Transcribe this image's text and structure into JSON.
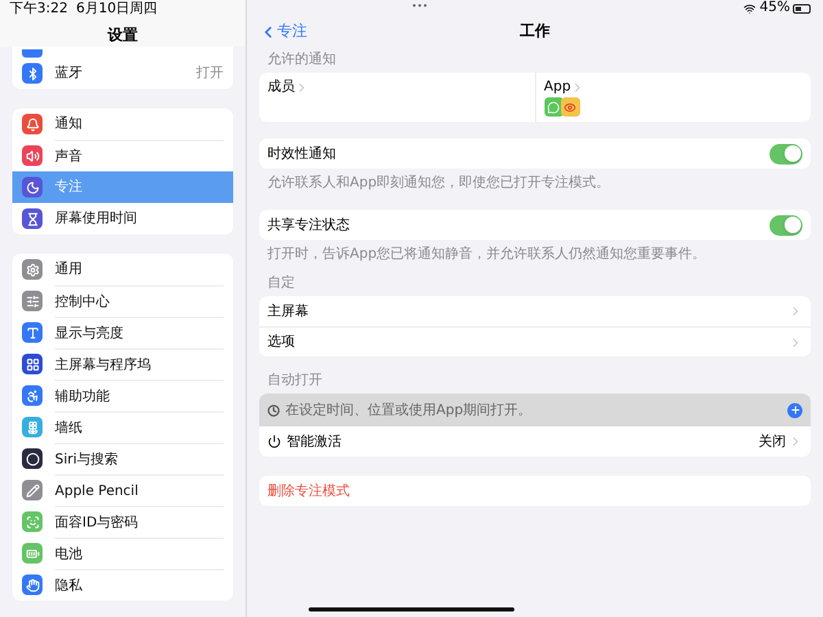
{
  "status_bar": {
    "time": "下午3:22",
    "date": "6月10日周四",
    "battery": "45%"
  },
  "sidebar": {
    "title": "设置",
    "groups": [
      {
        "items": [
          {
            "label": "蓝牙",
            "value": "打开",
            "color": "#3478f6",
            "selected": false
          }
        ]
      },
      {
        "items": [
          {
            "label": "通知",
            "color": "#eb4d3d",
            "selected": false
          },
          {
            "label": "声音",
            "color": "#eb445a",
            "selected": false
          },
          {
            "label": "专注",
            "color": "#5856d6",
            "selected": true
          },
          {
            "label": "屏幕使用时间",
            "color": "#5856d6",
            "selected": false
          }
        ]
      },
      {
        "items": [
          {
            "label": "通用",
            "color": "#8e8e93",
            "selected": false
          },
          {
            "label": "控制中心",
            "color": "#8e8e93",
            "selected": false
          },
          {
            "label": "显示与亮度",
            "color": "#3478f6",
            "selected": false
          },
          {
            "label": "主屏幕与程序坞",
            "color": "#2c4bd6",
            "selected": false
          },
          {
            "label": "辅助功能",
            "color": "#3478f6",
            "selected": false
          },
          {
            "label": "墙纸",
            "color": "#38aee0",
            "selected": false
          },
          {
            "label": "Siri与搜索",
            "color": "#2a2a40",
            "selected": false
          },
          {
            "label": "Apple Pencil",
            "color": "#8e8e93",
            "selected": false
          },
          {
            "label": "面容ID与密码",
            "color": "#65c466",
            "selected": false
          },
          {
            "label": "电池",
            "color": "#65c466",
            "selected": false
          },
          {
            "label": "隐私",
            "color": "#3478f6",
            "selected": false
          }
        ]
      }
    ]
  },
  "nav": {
    "back": "专注",
    "title": "工作"
  },
  "allowed": {
    "header": "允许的通知",
    "people": "成员",
    "apps": "App"
  },
  "toggles": [
    {
      "label": "时效性通知",
      "on": true,
      "note": "允许联系人和App即刻通知您，即使您已打开专注模式。"
    },
    {
      "label": "共享专注状态",
      "on": true,
      "note": "打开时，告诉App您已将通知静音，并允许联系人仍然通知您重要事件。"
    }
  ],
  "customize": {
    "header": "自定",
    "rows": [
      "主屏幕",
      "选项"
    ]
  },
  "auto_on": {
    "header": "自动打开",
    "hint": "在设定时间、位置或使用App期间打开。",
    "smart": {
      "label": "智能激活",
      "value": "关闭"
    }
  },
  "delete": "删除专注模式"
}
